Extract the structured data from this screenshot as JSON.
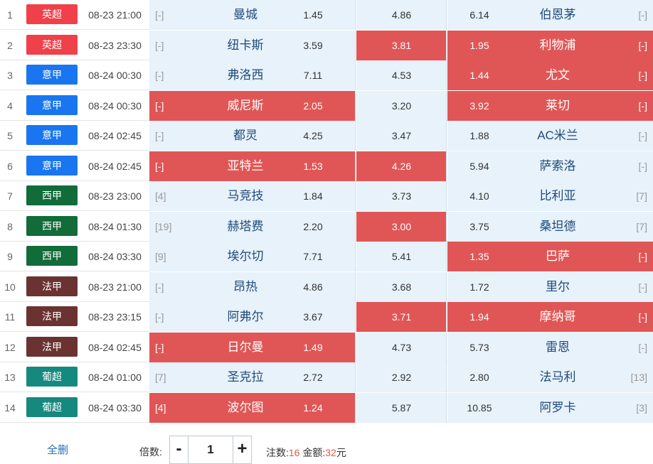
{
  "colors": {
    "英超": "#f0404a",
    "意甲": "#1976f0",
    "西甲": "#116c3a",
    "法甲": "#6b3232",
    "葡超": "#16897f",
    "selected": "#e05656",
    "zone": "#e7f2fb"
  },
  "matches": [
    {
      "idx": "1",
      "league": "英超",
      "time": "08-23 21:00",
      "home_rank": "[-]",
      "home": "曼城",
      "home_odd": "1.45",
      "draw_odd": "4.86",
      "away_odd": "6.14",
      "away": "伯恩茅",
      "away_rank": "[-]",
      "sel_home": false,
      "sel_draw": false,
      "sel_away": false
    },
    {
      "idx": "2",
      "league": "英超",
      "time": "08-23 23:30",
      "home_rank": "[-]",
      "home": "纽卡斯",
      "home_odd": "3.59",
      "draw_odd": "3.81",
      "away_odd": "1.95",
      "away": "利物浦",
      "away_rank": "[-]",
      "sel_home": false,
      "sel_draw": true,
      "sel_away": true
    },
    {
      "idx": "3",
      "league": "意甲",
      "time": "08-24 00:30",
      "home_rank": "[-]",
      "home": "弗洛西",
      "home_odd": "7.11",
      "draw_odd": "4.53",
      "away_odd": "1.44",
      "away": "尤文",
      "away_rank": "[-]",
      "sel_home": false,
      "sel_draw": false,
      "sel_away": true
    },
    {
      "idx": "4",
      "league": "意甲",
      "time": "08-24 00:30",
      "home_rank": "[-]",
      "home": "威尼斯",
      "home_odd": "2.05",
      "draw_odd": "3.20",
      "away_odd": "3.92",
      "away": "莱切",
      "away_rank": "[-]",
      "sel_home": true,
      "sel_draw": false,
      "sel_away": true
    },
    {
      "idx": "5",
      "league": "意甲",
      "time": "08-24 02:45",
      "home_rank": "[-]",
      "home": "都灵",
      "home_odd": "4.25",
      "draw_odd": "3.47",
      "away_odd": "1.88",
      "away": "AC米兰",
      "away_rank": "[-]",
      "sel_home": false,
      "sel_draw": false,
      "sel_away": false
    },
    {
      "idx": "6",
      "league": "意甲",
      "time": "08-24 02:45",
      "home_rank": "[-]",
      "home": "亚特兰",
      "home_odd": "1.53",
      "draw_odd": "4.26",
      "away_odd": "5.94",
      "away": "萨索洛",
      "away_rank": "[-]",
      "sel_home": true,
      "sel_draw": true,
      "sel_away": false
    },
    {
      "idx": "7",
      "league": "西甲",
      "time": "08-23 23:00",
      "home_rank": "[4]",
      "home": "马竞技",
      "home_odd": "1.84",
      "draw_odd": "3.73",
      "away_odd": "4.10",
      "away": "比利亚",
      "away_rank": "[7]",
      "sel_home": false,
      "sel_draw": false,
      "sel_away": false
    },
    {
      "idx": "8",
      "league": "西甲",
      "time": "08-24 01:30",
      "home_rank": "[19]",
      "home": "赫塔费",
      "home_odd": "2.20",
      "draw_odd": "3.00",
      "away_odd": "3.75",
      "away": "桑坦德",
      "away_rank": "[7]",
      "sel_home": false,
      "sel_draw": true,
      "sel_away": false
    },
    {
      "idx": "9",
      "league": "西甲",
      "time": "08-24 03:30",
      "home_rank": "[9]",
      "home": "埃尔切",
      "home_odd": "7.71",
      "draw_odd": "5.41",
      "away_odd": "1.35",
      "away": "巴萨",
      "away_rank": "[-]",
      "sel_home": false,
      "sel_draw": false,
      "sel_away": true
    },
    {
      "idx": "10",
      "league": "法甲",
      "time": "08-23 21:00",
      "home_rank": "[-]",
      "home": "昂热",
      "home_odd": "4.86",
      "draw_odd": "3.68",
      "away_odd": "1.72",
      "away": "里尔",
      "away_rank": "[-]",
      "sel_home": false,
      "sel_draw": false,
      "sel_away": false
    },
    {
      "idx": "11",
      "league": "法甲",
      "time": "08-23 23:15",
      "home_rank": "[-]",
      "home": "阿弗尔",
      "home_odd": "3.67",
      "draw_odd": "3.71",
      "away_odd": "1.94",
      "away": "摩纳哥",
      "away_rank": "[-]",
      "sel_home": false,
      "sel_draw": true,
      "sel_away": true
    },
    {
      "idx": "12",
      "league": "法甲",
      "time": "08-24 02:45",
      "home_rank": "[-]",
      "home": "日尔曼",
      "home_odd": "1.49",
      "draw_odd": "4.73",
      "away_odd": "5.73",
      "away": "雷恩",
      "away_rank": "[-]",
      "sel_home": true,
      "sel_draw": false,
      "sel_away": false
    },
    {
      "idx": "13",
      "league": "葡超",
      "time": "08-24 01:00",
      "home_rank": "[7]",
      "home": "圣克拉",
      "home_odd": "2.72",
      "draw_odd": "2.92",
      "away_odd": "2.80",
      "away": "法马利",
      "away_rank": "[13]",
      "sel_home": false,
      "sel_draw": false,
      "sel_away": false
    },
    {
      "idx": "14",
      "league": "葡超",
      "time": "08-24 03:30",
      "home_rank": "[4]",
      "home": "波尔图",
      "home_odd": "1.24",
      "draw_odd": "5.87",
      "away_odd": "10.85",
      "away": "阿罗卡",
      "away_rank": "[3]",
      "sel_home": true,
      "sel_draw": false,
      "sel_away": false
    }
  ],
  "footer": {
    "clear_label": "全删",
    "multiplier_label": "倍数:",
    "minus": "-",
    "plus": "+",
    "multiplier_value": "1",
    "bets_label": "注数:",
    "bets_value": "16",
    "amount_label": "金额:",
    "amount_value": "32",
    "currency": "元"
  }
}
